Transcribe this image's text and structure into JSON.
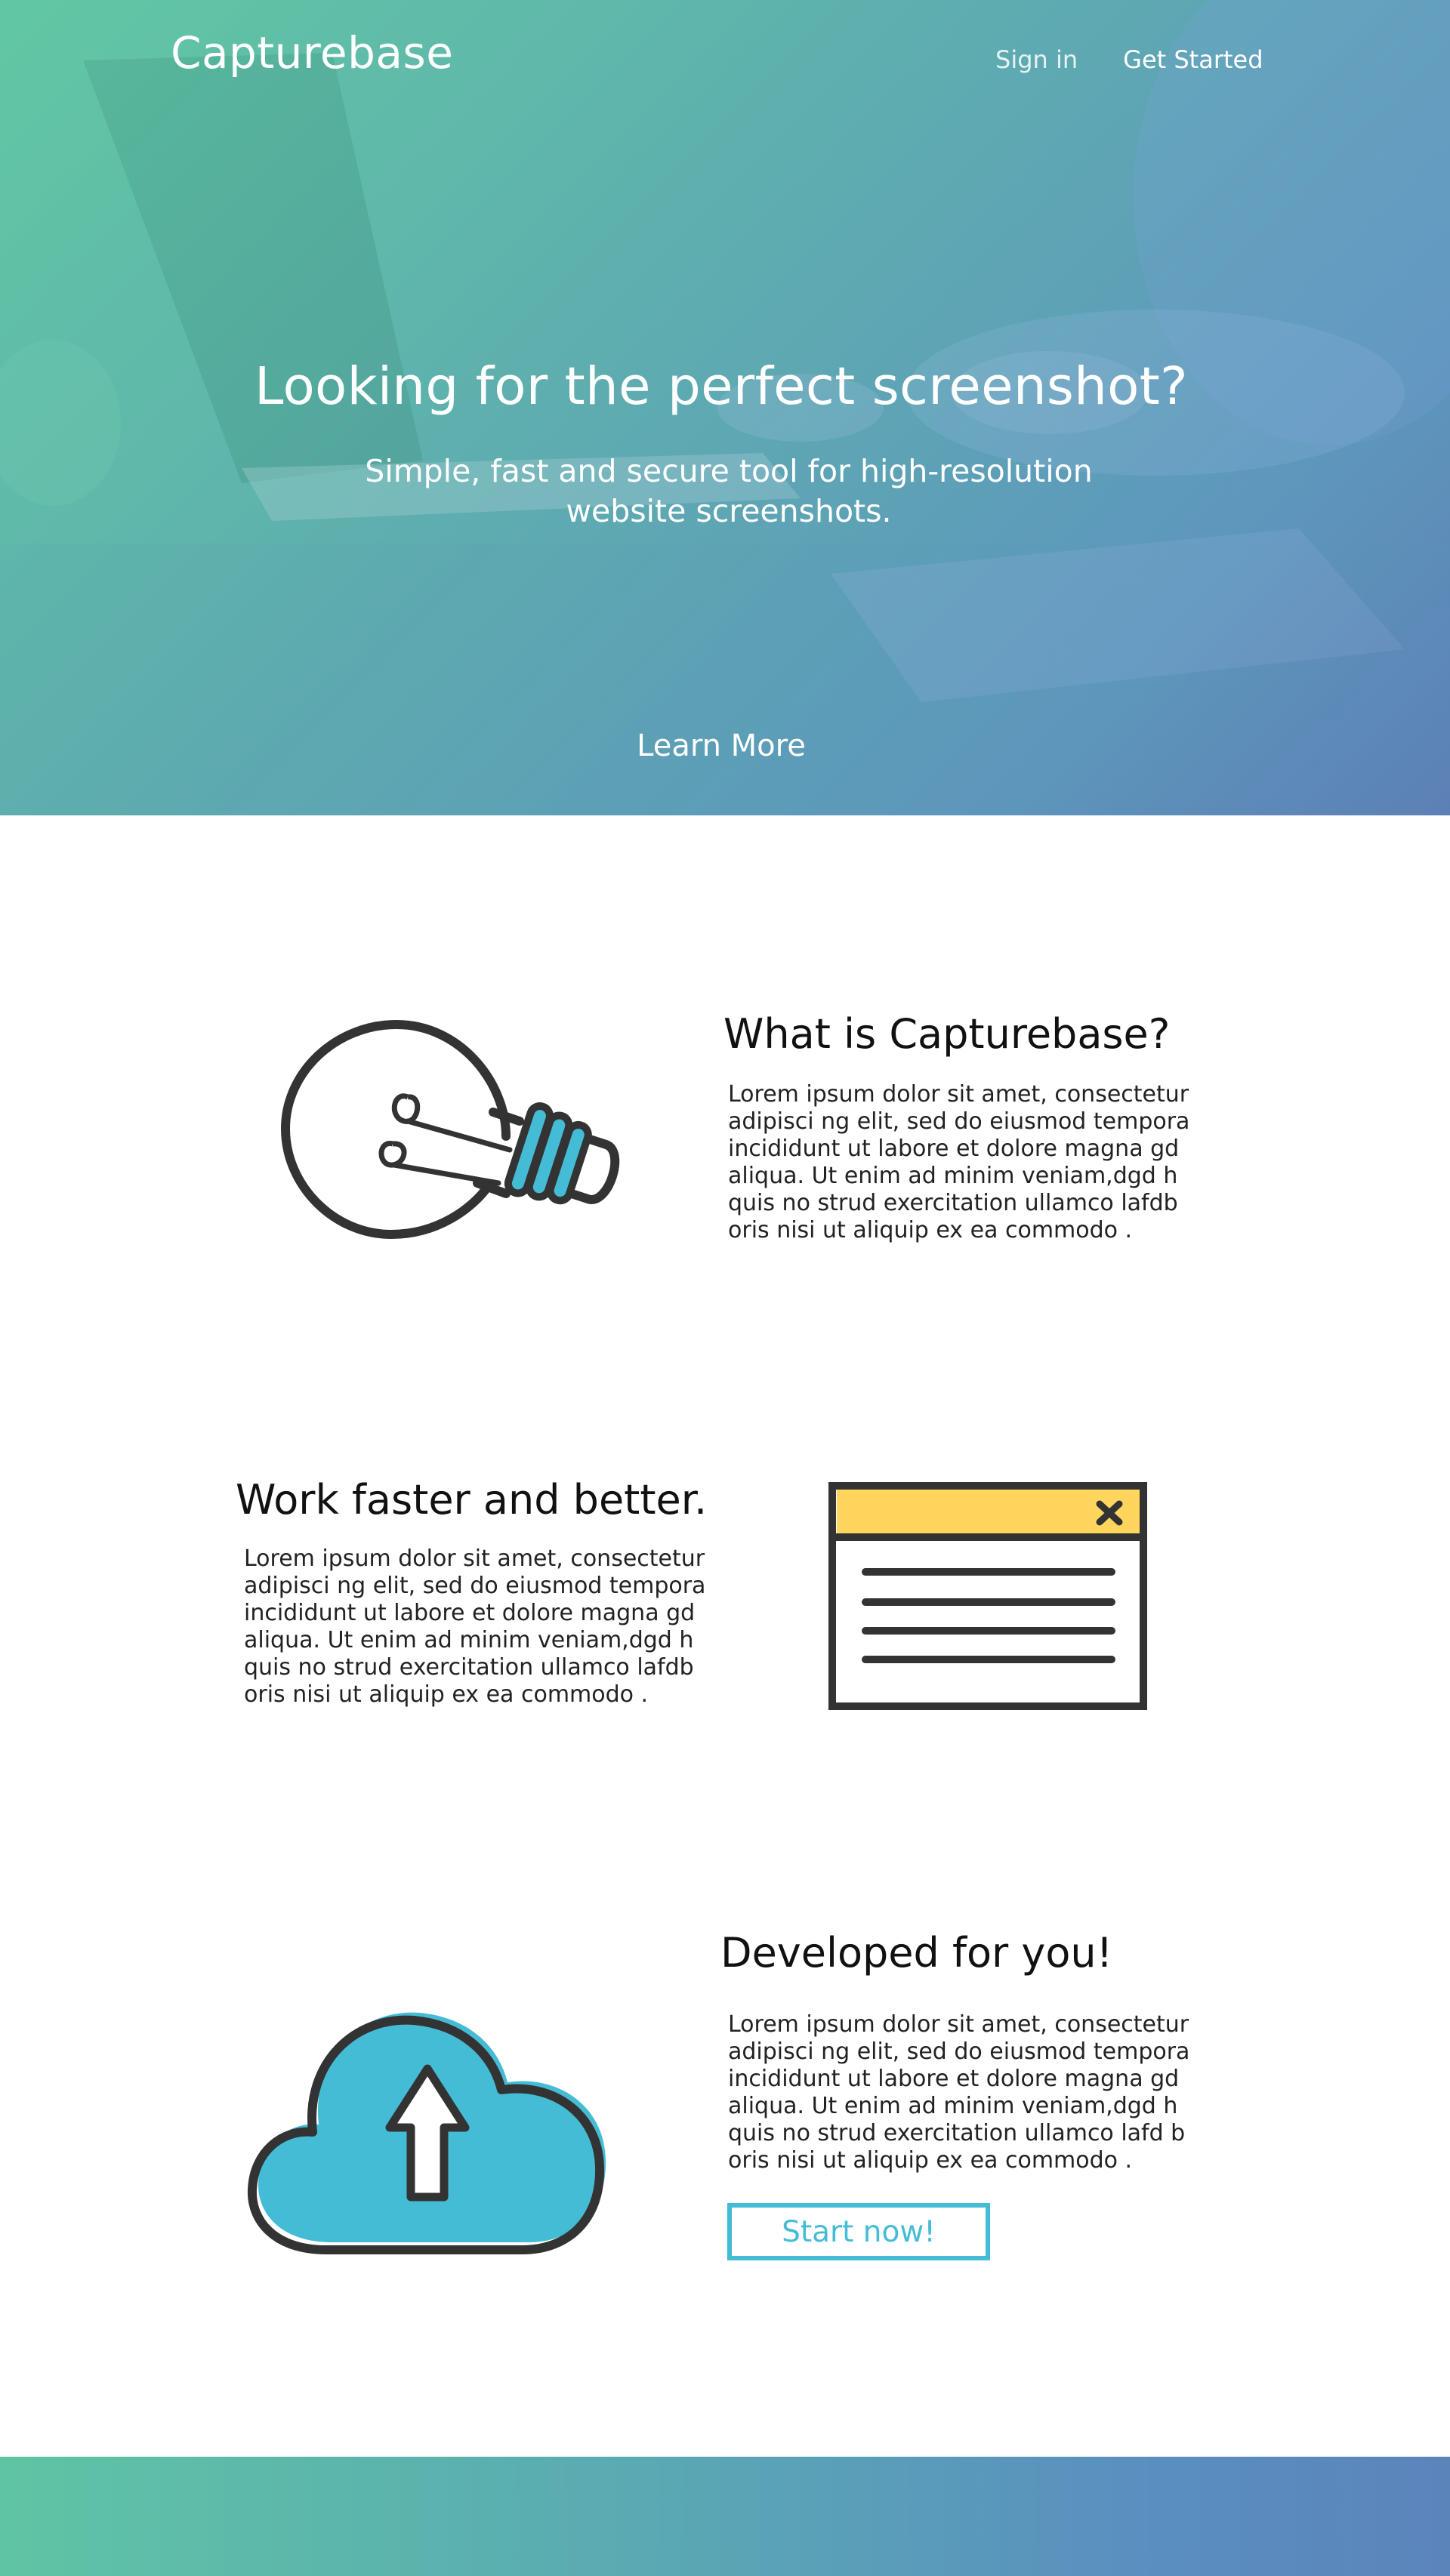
{
  "header": {
    "logo": "Capturebase",
    "nav": {
      "sign_in": "Sign in",
      "get_started": "Get Started"
    }
  },
  "hero": {
    "title": "Looking for the perfect screenshot?",
    "subtitle": "Simple, fast and secure tool for high-resolution website screenshots.",
    "cta": "Learn More"
  },
  "features": [
    {
      "title": "What is Capturebase?",
      "text": "Lorem ipsum dolor sit amet, consectetur adipisci ng elit, sed do eiusmod tempora incididunt ut labore et dolore magna gd aliqua. Ut enim ad minim veniam,dgd h quis no strud exercitation ullamco lafdb oris nisi ut aliquip ex ea commodo .",
      "icon": "lightbulb-icon"
    },
    {
      "title": "Work faster and better.",
      "text": "Lorem ipsum dolor sit amet, consectetur adipisci ng elit, sed do eiusmod tempora incididunt ut labore et dolore magna gd aliqua. Ut enim ad minim veniam,dgd h quis no strud exercitation ullamco lafdb oris nisi ut aliquip ex ea commodo .",
      "icon": "browser-window-icon"
    },
    {
      "title": "Developed for you!",
      "text": "Lorem ipsum dolor sit amet, consectetur adipisci ng elit, sed do eiusmod tempora incididunt ut labore et dolore magna gd aliqua. Ut enim ad minim veniam,dgd h quis no strud exercitation ullamco lafd b oris nisi ut aliquip ex ea commodo .",
      "icon": "cloud-upload-icon",
      "button": "Start now!"
    }
  ],
  "colors": {
    "accent_blue": "#45bcd6",
    "accent_yellow": "#ffd55e",
    "icon_stroke": "#333333",
    "gradient_start": "#5fc8a3",
    "gradient_end": "#5b74b8"
  }
}
